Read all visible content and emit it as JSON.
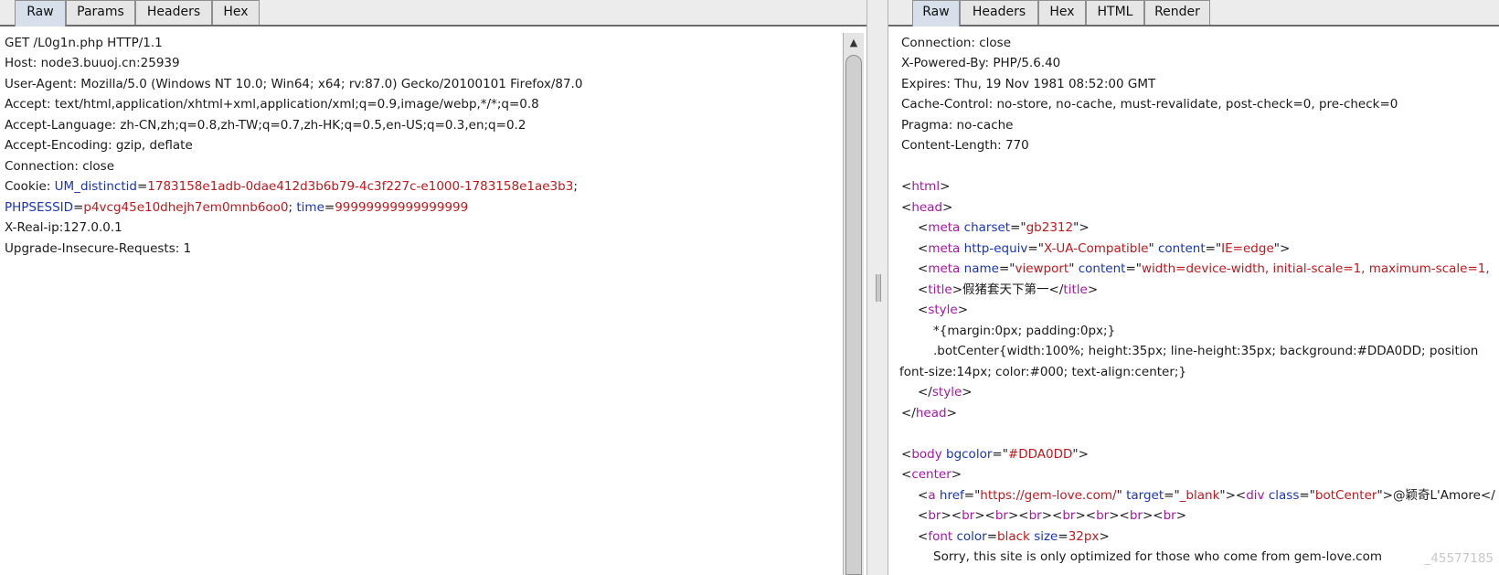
{
  "request_panel": {
    "tabs": [
      "Raw",
      "Params",
      "Headers",
      "Hex"
    ],
    "active_tab": "Raw",
    "lines": [
      "GET /L0g1n.php HTTP/1.1",
      "Host: node3.buuoj.cn:25939",
      "User-Agent: Mozilla/5.0 (Windows NT 10.0; Win64; x64; rv:87.0) Gecko/20100101 Firefox/87.0",
      "Accept: text/html,application/xhtml+xml,application/xml;q=0.9,image/webp,*/*;q=0.8",
      "Accept-Language: zh-CN,zh;q=0.8,zh-TW;q=0.7,zh-HK;q=0.5,en-US;q=0.3,en;q=0.2",
      "Accept-Encoding: gzip, deflate",
      "Connection: close",
      "X-Real-ip:127.0.0.1",
      "Upgrade-Insecure-Requests: 1"
    ],
    "cookie": {
      "label": "Cookie: ",
      "um_key": "UM_distinctid",
      "um_value": "1783158e1adb-0dae412d3b6b79-4c3f227c-e1000-1783158e1ae3b3",
      "sess_key": "PHPSESSID",
      "sess_value": "p4vcg45e10dhejh7em0mnb6oo0",
      "time_key": "time",
      "time_value": "99999999999999999"
    }
  },
  "response_panel": {
    "tabs": [
      "Raw",
      "Headers",
      "Hex",
      "HTML",
      "Render"
    ],
    "active_tab": "Raw",
    "headers": [
      "Connection: close",
      "X-Powered-By: PHP/5.6.40",
      "Expires: Thu, 19 Nov 1981 08:52:00 GMT",
      "Cache-Control: no-store, no-cache, must-revalidate, post-check=0, pre-check=0",
      "Pragma: no-cache",
      "Content-Length: 770"
    ],
    "body": {
      "meta_charset_value": "gb2312",
      "meta_httpequiv_value": "X-UA-Compatible",
      "meta_content_value": "IE=edge",
      "meta_name_value": "viewport",
      "meta_viewport_content": "width=device-width, initial-scale=1, maximum-scale=1,",
      "title_text": "假猪套天下第一",
      "style_rule_1": "*{margin:0px; padding:0px;}",
      "style_rule_2": ".botCenter{width:100%; height:35px; line-height:35px; background:#DDA0DD; position",
      "style_rule_2b": "font-size:14px; color:#000; text-align:center;}",
      "bgcolor_value": "#DDA0DD",
      "href_value": "https://gem-love.com/",
      "target_value": "_blank",
      "class_value": "botCenter",
      "link_text": "@颖奇L'Amore</",
      "font_color_value": "black",
      "font_size_value": "32px",
      "sorry_text": "Sorry, this site is only optimized for those who come from gem-love.com"
    }
  },
  "watermark": "_45577185"
}
